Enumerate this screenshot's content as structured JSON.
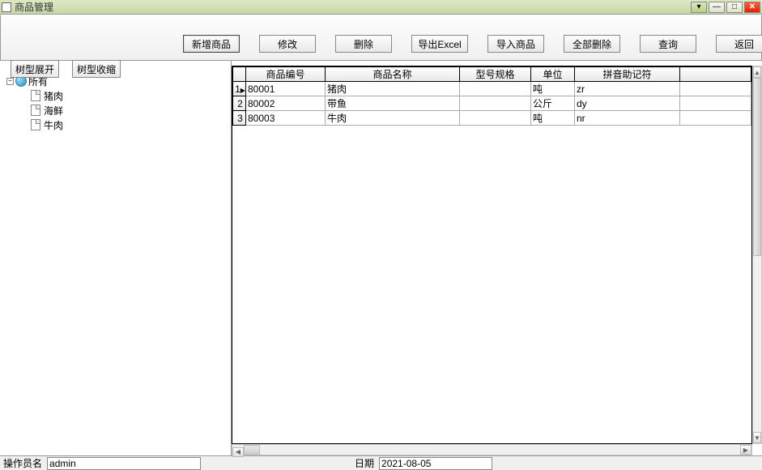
{
  "window": {
    "title": "商品管理"
  },
  "toolbar": {
    "add": "新增商品",
    "edit": "修改",
    "delete": "删除",
    "export": "导出Excel",
    "import": "导入商品",
    "deleteAll": "全部删除",
    "query": "查询",
    "back": "返回",
    "treeExpand": "树型展开",
    "treeCollapse": "树型收缩"
  },
  "tree": {
    "root": "所有",
    "children": [
      "猪肉",
      "海鲜",
      "牛肉"
    ]
  },
  "grid": {
    "headers": {
      "code": "商品编号",
      "name": "商品名称",
      "spec": "型号规格",
      "unit": "单位",
      "pinyin": "拼音助记符"
    },
    "rows": [
      {
        "num": "1",
        "code": "80001",
        "name": "猪肉",
        "spec": "",
        "unit": "吨",
        "pinyin": "zr"
      },
      {
        "num": "2",
        "code": "80002",
        "name": "带鱼",
        "spec": "",
        "unit": "公斤",
        "pinyin": "dy"
      },
      {
        "num": "3",
        "code": "80003",
        "name": "牛肉",
        "spec": "",
        "unit": "吨",
        "pinyin": "nr"
      }
    ]
  },
  "status": {
    "operatorLabel": "操作员名",
    "operator": "admin",
    "dateLabel": "日期",
    "date": "2021-08-05"
  }
}
